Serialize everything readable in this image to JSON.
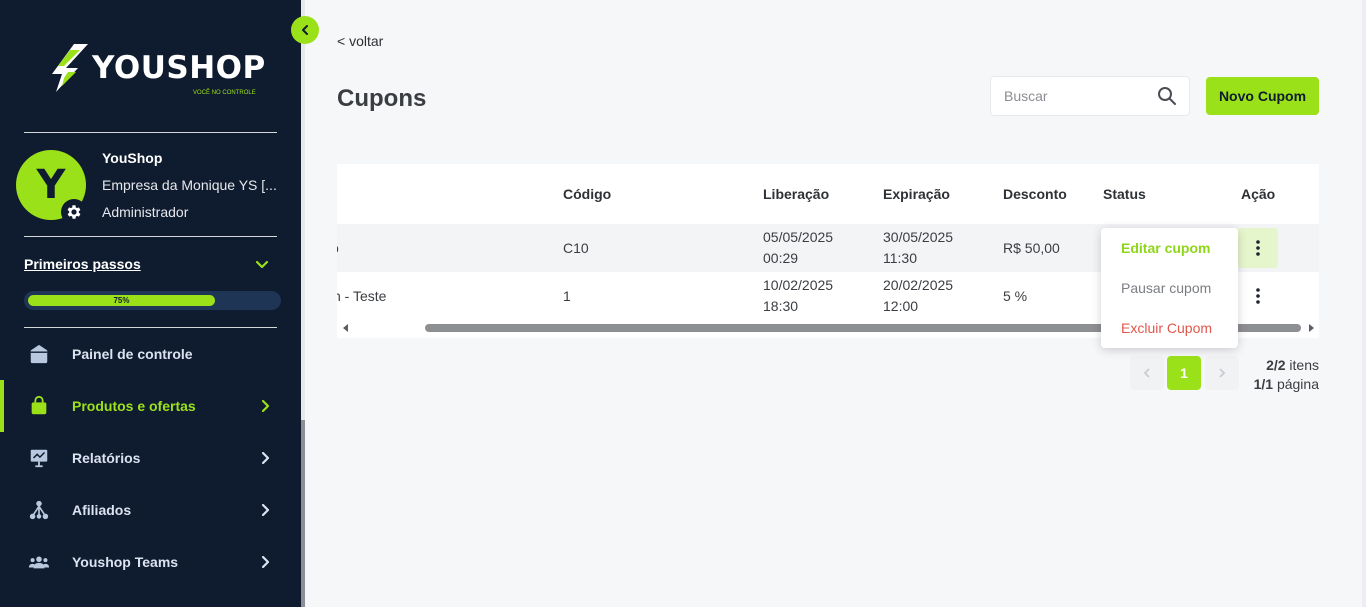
{
  "sidebar": {
    "logo_text": "YOUSHOP",
    "logo_tagline": "VOCÊ NO CONTROLE",
    "user": {
      "initial": "Y",
      "name": "YouShop",
      "company": "Empresa da Monique YS [...",
      "role": "Administrador"
    },
    "first_steps": {
      "label": "Primeiros passos",
      "progress": 75,
      "progress_label": "75%"
    },
    "nav": [
      {
        "label": "Painel de controle",
        "icon": "dashboard-icon",
        "active": false,
        "has_chevron": false
      },
      {
        "label": "Produtos e ofertas",
        "icon": "shopping-bag-icon",
        "active": true,
        "has_chevron": true
      },
      {
        "label": "Relatórios",
        "icon": "report-board-icon",
        "active": false,
        "has_chevron": true
      },
      {
        "label": "Afiliados",
        "icon": "affiliates-network-icon",
        "active": false,
        "has_chevron": true
      },
      {
        "label": "Youshop Teams",
        "icon": "team-icon",
        "active": false,
        "has_chevron": true
      }
    ]
  },
  "header": {
    "back_label": "< voltar",
    "title": "Cupons",
    "search_placeholder": "Buscar",
    "new_button": "Novo Cupom"
  },
  "table": {
    "columns": [
      "Código",
      "Liberação",
      "Expiração",
      "Desconto",
      "Status",
      "Ação"
    ],
    "rows": [
      {
        "name_fragment": "o",
        "code": "C10",
        "release_date": "05/05/2025",
        "release_time": "00:29",
        "expire_date": "30/05/2025",
        "expire_time": "11:30",
        "discount": "R$ 50,00"
      },
      {
        "name_fragment": "n - Teste",
        "code": "1",
        "release_date": "10/02/2025",
        "release_time": "18:30",
        "expire_date": "20/02/2025",
        "expire_time": "12:00",
        "discount": "5 %"
      }
    ]
  },
  "action_menu": {
    "edit": "Editar cupom",
    "pause": "Pausar cupom",
    "delete": "Excluir Cupom"
  },
  "pagination": {
    "current_page": "1",
    "items_count": "2/2",
    "items_label": " itens",
    "pages_count": "1/1",
    "pages_label": " página"
  },
  "colors": {
    "brand_green": "#9be11a",
    "sidebar_bg": "#0f1b2e",
    "danger": "#e2574c"
  }
}
